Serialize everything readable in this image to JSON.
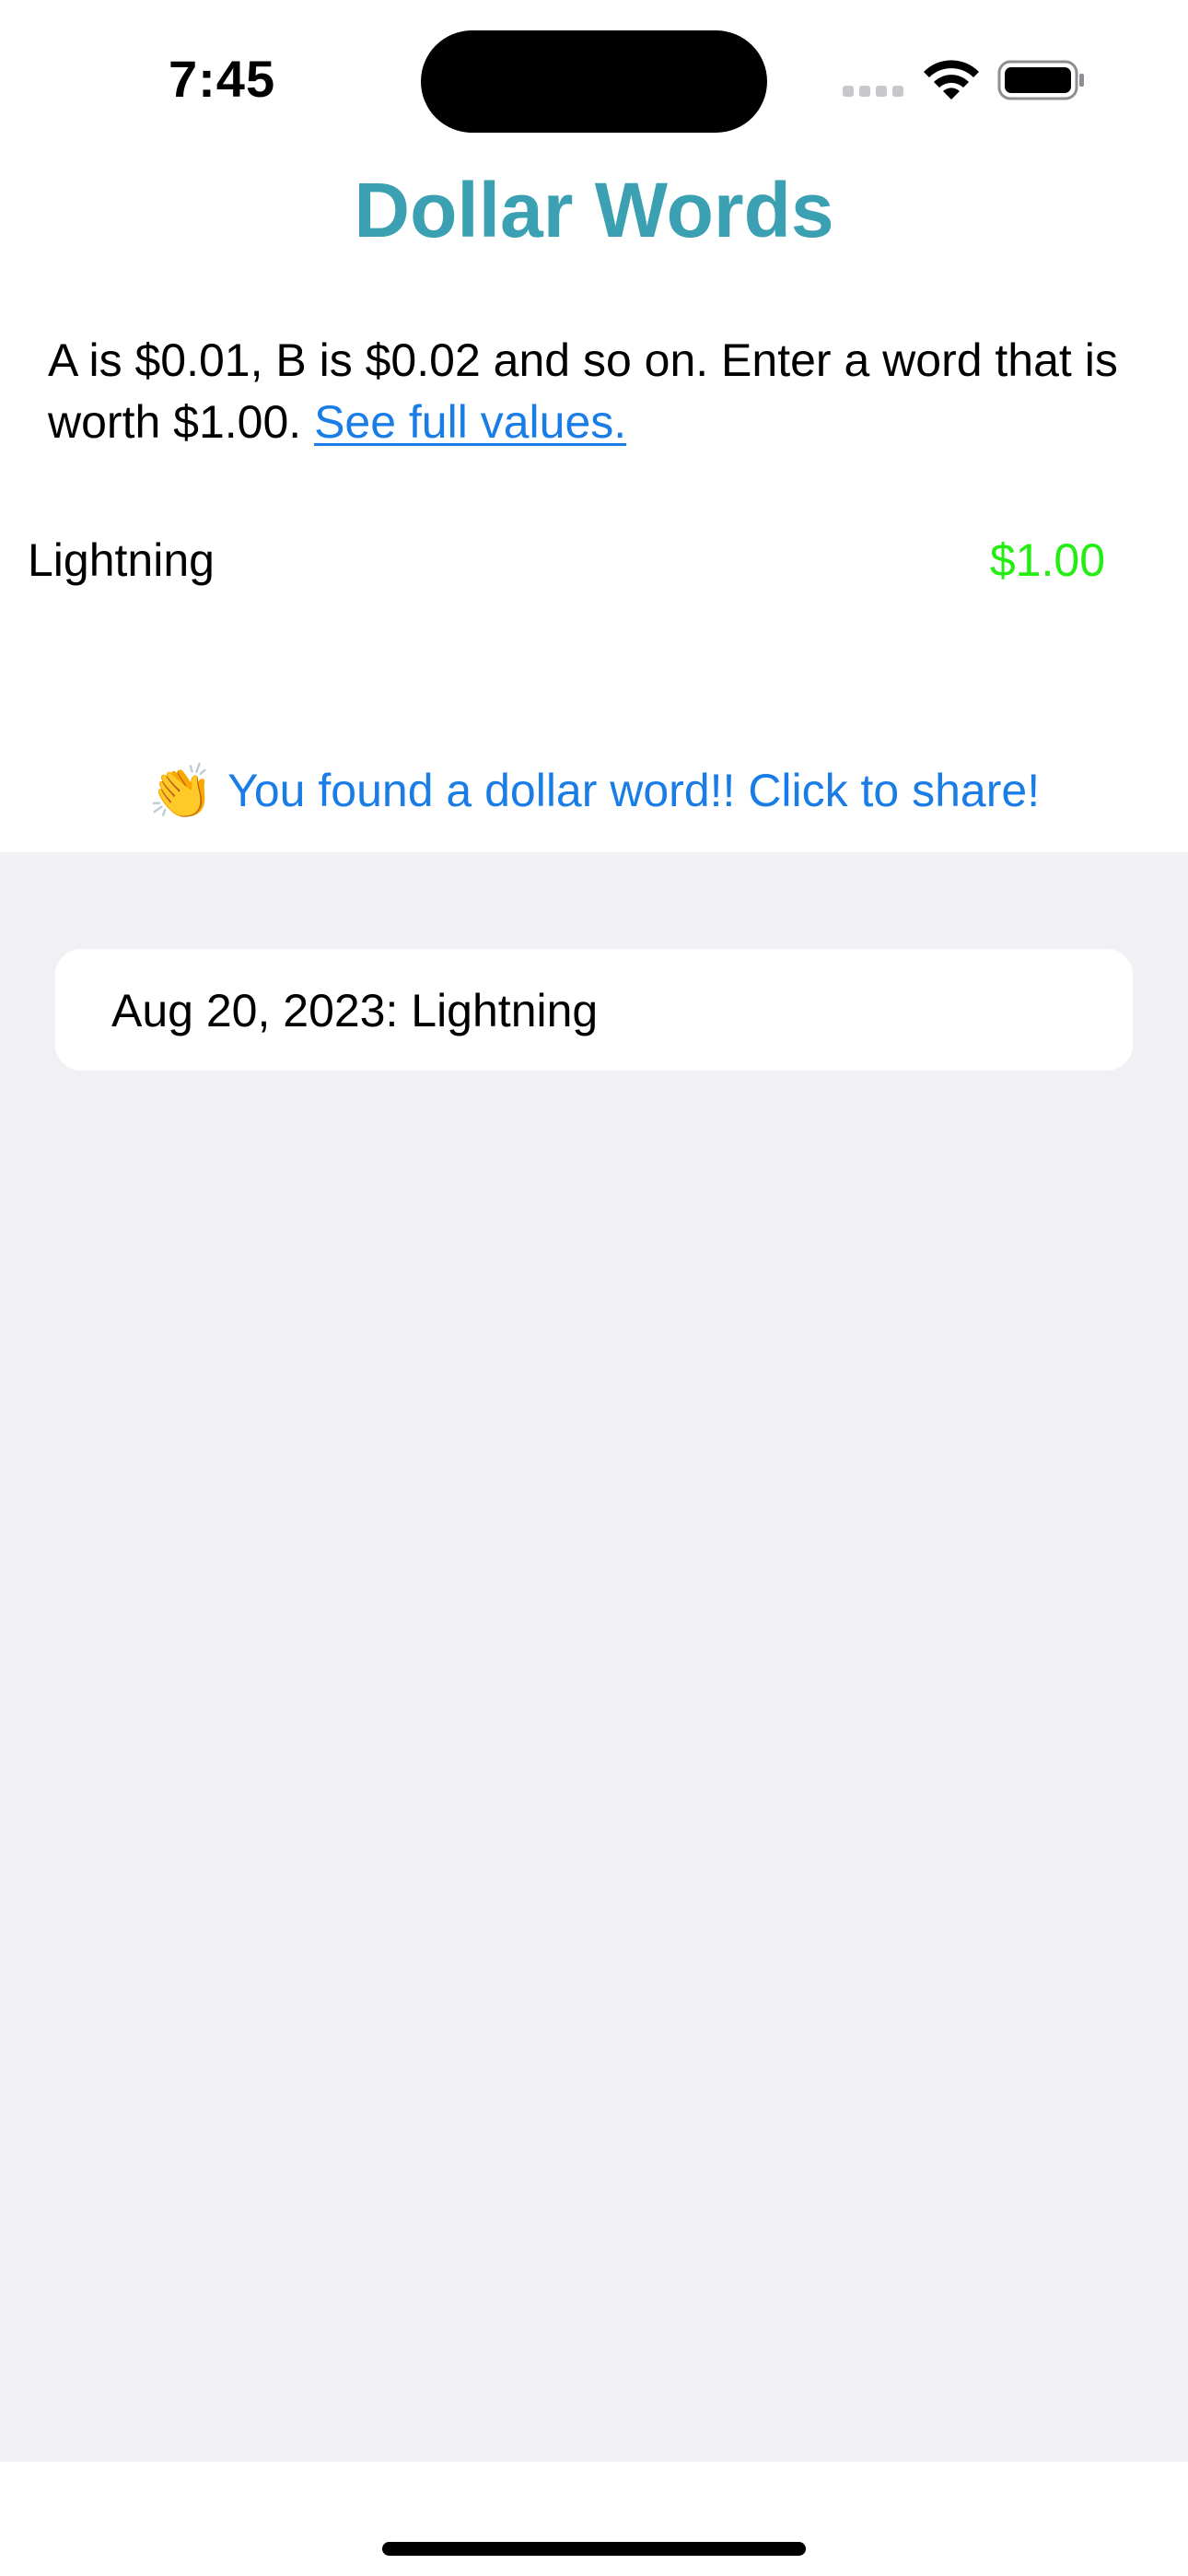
{
  "status_bar": {
    "time": "7:45",
    "icons": [
      "cellular-signal-icon",
      "wifi-icon",
      "battery-icon"
    ]
  },
  "header": {
    "title": "Dollar Words",
    "title_color": "#3ba0b1"
  },
  "intro": {
    "text": "A is $0.01, B is $0.02 and so on. Enter a word that is worth $1.00. ",
    "link_label": "See full values."
  },
  "word_entry": {
    "value": "Lightning",
    "dollar_value": "$1.00",
    "value_color": "#22ee11"
  },
  "share": {
    "emoji": "👏",
    "label": "You found a dollar word!! Click to share!",
    "link_color": "#1a7de6"
  },
  "history": {
    "items": [
      {
        "label": "Aug 20, 2023: Lightning"
      }
    ]
  }
}
